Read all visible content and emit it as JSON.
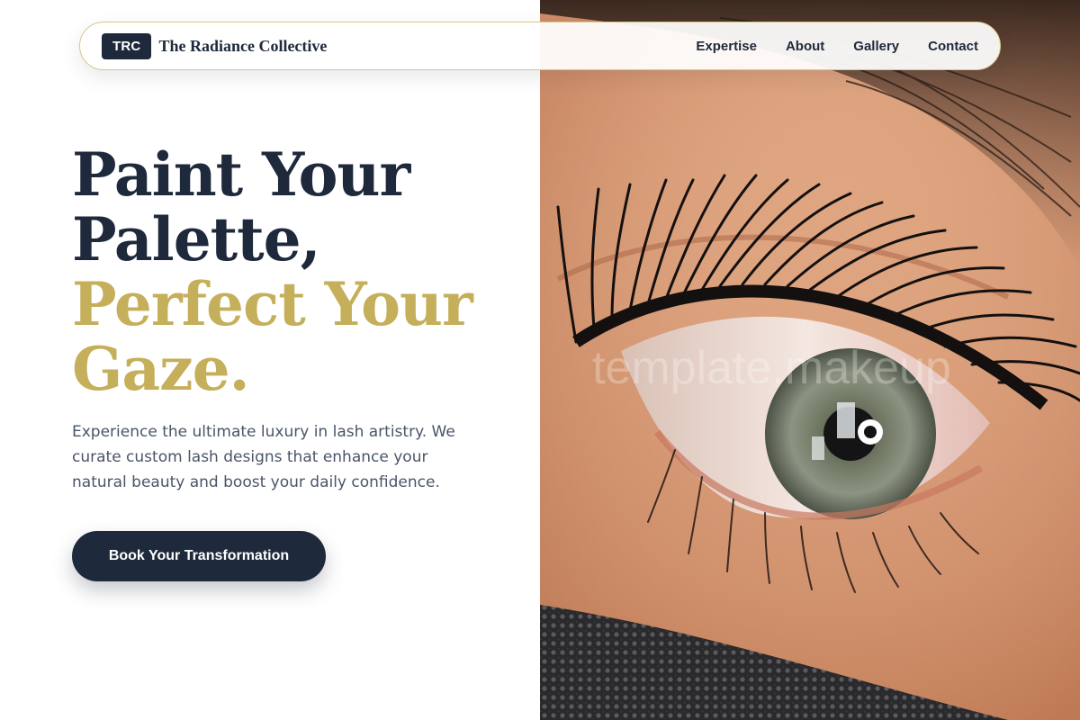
{
  "brand": {
    "badge": "TRC",
    "name": "The Radiance Collective"
  },
  "nav": {
    "links": [
      "Expertise",
      "About",
      "Gallery",
      "Contact"
    ]
  },
  "hero": {
    "headline_dark": [
      "Paint Your",
      "Palette,"
    ],
    "headline_gold": [
      "Perfect Your",
      "Gaze."
    ],
    "description": "Experience the ultimate luxury in lash artistry. We curate custom lash designs that enhance your natural beauty and boost your daily confidence.",
    "cta_label": "Book Your Transformation",
    "image_watermark": "template.makeup"
  },
  "colors": {
    "navy": "#1e293b",
    "gold": "#c5af5a",
    "body_text": "#4a5568",
    "nav_border": "#d8c68c"
  }
}
